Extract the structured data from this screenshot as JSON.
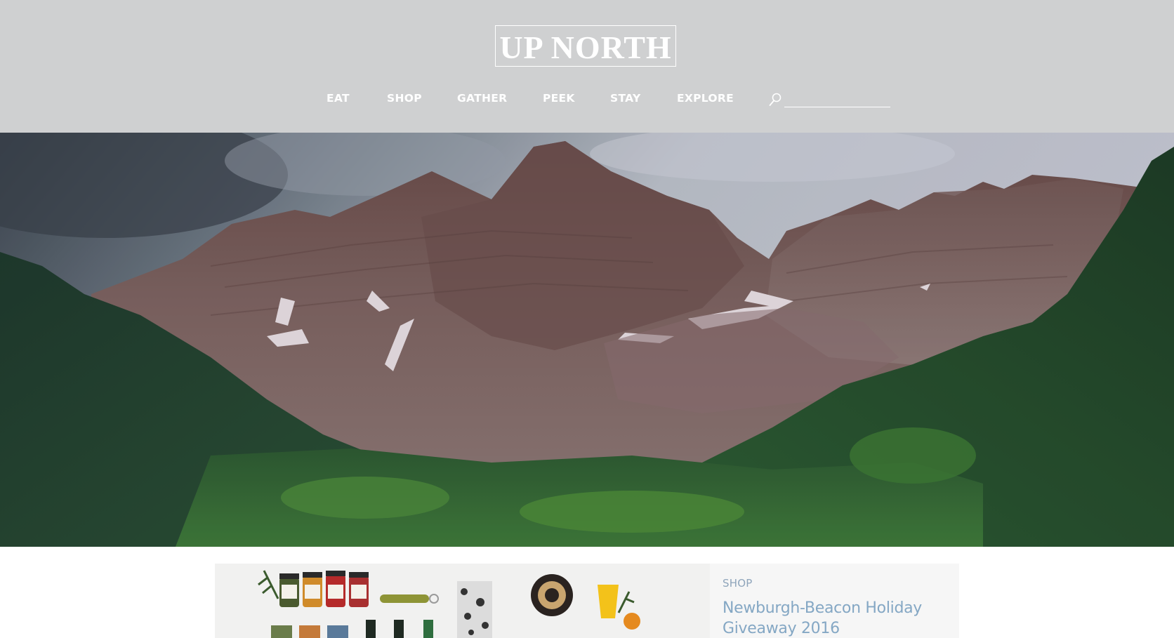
{
  "site": {
    "logo_text": "UP NORTH"
  },
  "nav": {
    "items": [
      {
        "label": "EAT"
      },
      {
        "label": "SHOP"
      },
      {
        "label": "GATHER"
      },
      {
        "label": "PEEK"
      },
      {
        "label": "STAY"
      },
      {
        "label": "EXPLORE"
      }
    ],
    "search_placeholder": ""
  },
  "hero": {
    "icon": "mountain-landscape-photo"
  },
  "featured_post": {
    "category": "SHOP",
    "title": "Newburgh-Beacon Holiday Giveaway 2016"
  },
  "colors": {
    "header_bg": "#cfd0d1",
    "accent_link": "#84a7c4",
    "category": "#8fa5bb",
    "card_bg": "#f6f6f6"
  }
}
